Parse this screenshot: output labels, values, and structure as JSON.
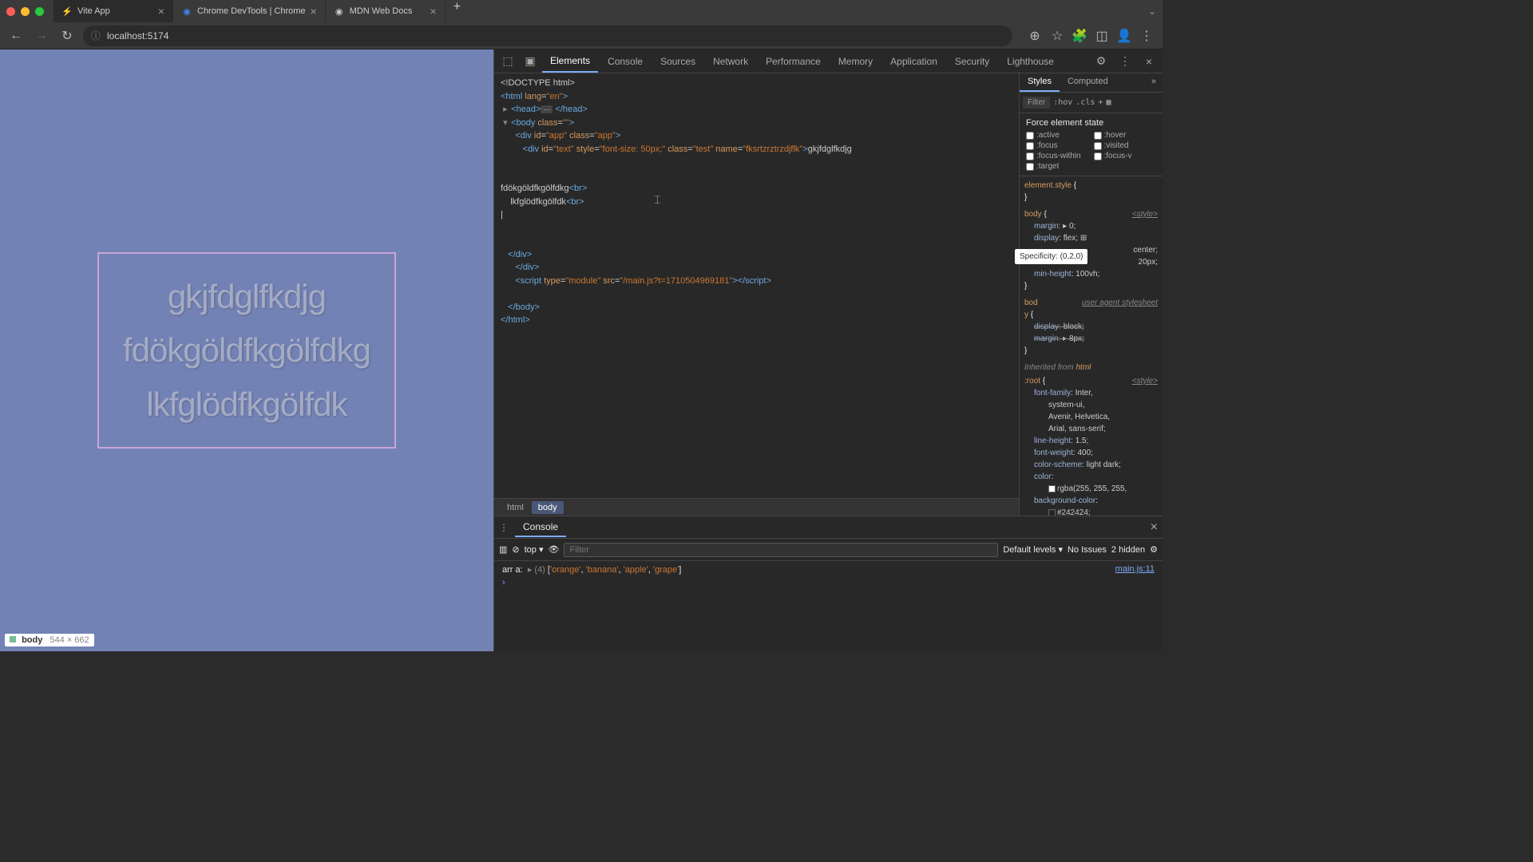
{
  "browser": {
    "tabs": [
      {
        "favicon": "⚡",
        "title": "Vite App",
        "active": true
      },
      {
        "favicon": "◆",
        "title": "Chrome DevTools | Chrome"
      },
      {
        "favicon": "◉",
        "title": "MDN Web Docs"
      }
    ],
    "url": "localhost:5174"
  },
  "page": {
    "lines": [
      "gkjfdglfkdjg",
      "fdökgöldfkgölfdkg",
      "lkfglödfkgölfdk"
    ],
    "hover_label": "body",
    "hover_dims": "544 × 662"
  },
  "devtools": {
    "tabs": [
      "Elements",
      "Console",
      "Sources",
      "Network",
      "Performance",
      "Memory",
      "Application",
      "Security",
      "Lighthouse"
    ],
    "active_tab": "Elements",
    "breadcrumb": [
      "html",
      "body"
    ],
    "breadcrumb_sel": "body",
    "dom": {
      "doctype": "<!DOCTYPE html>",
      "html_open": "<html lang=\"en\">",
      "head": "<head> ⋯ </head>",
      "body_open": "<body class=\"\">",
      "app_open": "<div id=\"app\" class=\"app\">",
      "text_div": "<div id=\"text\" style=\"font-size: 50px;\" class=\"test\" name=\"fksrtzrztrzdjflk\">gkjfdglfkdjg",
      "line2": "fdökgöldfkgölfdkg<br>",
      "line3": "    lkfglödfkgölfdk<br>",
      "div_close": "</div>",
      "app_close": "</div>",
      "script": "<script type=\"module\" src=\"/main.js?t=1710504969181\"></script>",
      "body_close": "</body>",
      "html_close": "</html>"
    },
    "styles": {
      "tabs": [
        "Styles",
        "Computed"
      ],
      "filter_ph": "Filter",
      "hov": ":hov",
      "cls": ".cls",
      "force_state": "Force element state",
      "states": [
        ":active",
        ":hover",
        ":focus",
        ":visited",
        ":focus-within",
        ":focus-v",
        ":target"
      ],
      "specificity": "Specificity: (0,2,0)",
      "rules": [
        {
          "sel": "element.style {",
          "origin": "",
          "props": [],
          "close": "}"
        },
        {
          "sel": "body {",
          "origin": "<style>",
          "props": [
            {
              "n": "margin",
              "v": "▸ 0;"
            },
            {
              "n": "display",
              "v": "flex; ⊞"
            },
            {
              "n": "",
              "v": "center;",
              "extra": true
            },
            {
              "n": "",
              "v": "20px;",
              "extra": true
            },
            {
              "n": "min-height",
              "v": "100vh;"
            }
          ],
          "close": "}"
        },
        {
          "sel": "bod",
          "origin": "user agent stylesheet",
          "sel2": "y {",
          "props": [
            {
              "n": "display",
              "v": "block;",
              "struck": true
            },
            {
              "n": "margin",
              "v": "▸ 8px;",
              "struck": true
            }
          ],
          "close": "}"
        }
      ],
      "inherited": "Inherited from",
      "inherited_from": "html",
      "root_rule": {
        "sel": ":root {",
        "origin": "<style>",
        "props": [
          {
            "n": "font-family",
            "v": "Inter,"
          },
          {
            "v": "system-ui,"
          },
          {
            "v": "Avenir, Helvetica,"
          },
          {
            "v": "Arial, sans-serif;"
          },
          {
            "n": "line-height",
            "v": "1.5;"
          },
          {
            "n": "font-weight",
            "v": "400;"
          },
          {
            "n": "color-scheme",
            "v": "light dark;"
          },
          {
            "n": "color",
            "v": ""
          },
          {
            "v": "rgba(255, 255, 255,",
            "swatch": "#fff"
          },
          {
            "n": "background-color",
            "v": ""
          },
          {
            "v": "#242424;",
            "swatch": "#242424"
          }
        ]
      }
    },
    "console": {
      "tab": "Console",
      "context": "top",
      "filter_ph": "Filter",
      "levels": "Default levels",
      "issues": "No Issues",
      "hidden": "2 hidden",
      "log_prefix": "arr a:",
      "log_count": "(4)",
      "log_items": [
        "'orange'",
        "'banana'",
        "'apple'",
        "'grape'"
      ],
      "log_src": "main.js:11"
    }
  }
}
